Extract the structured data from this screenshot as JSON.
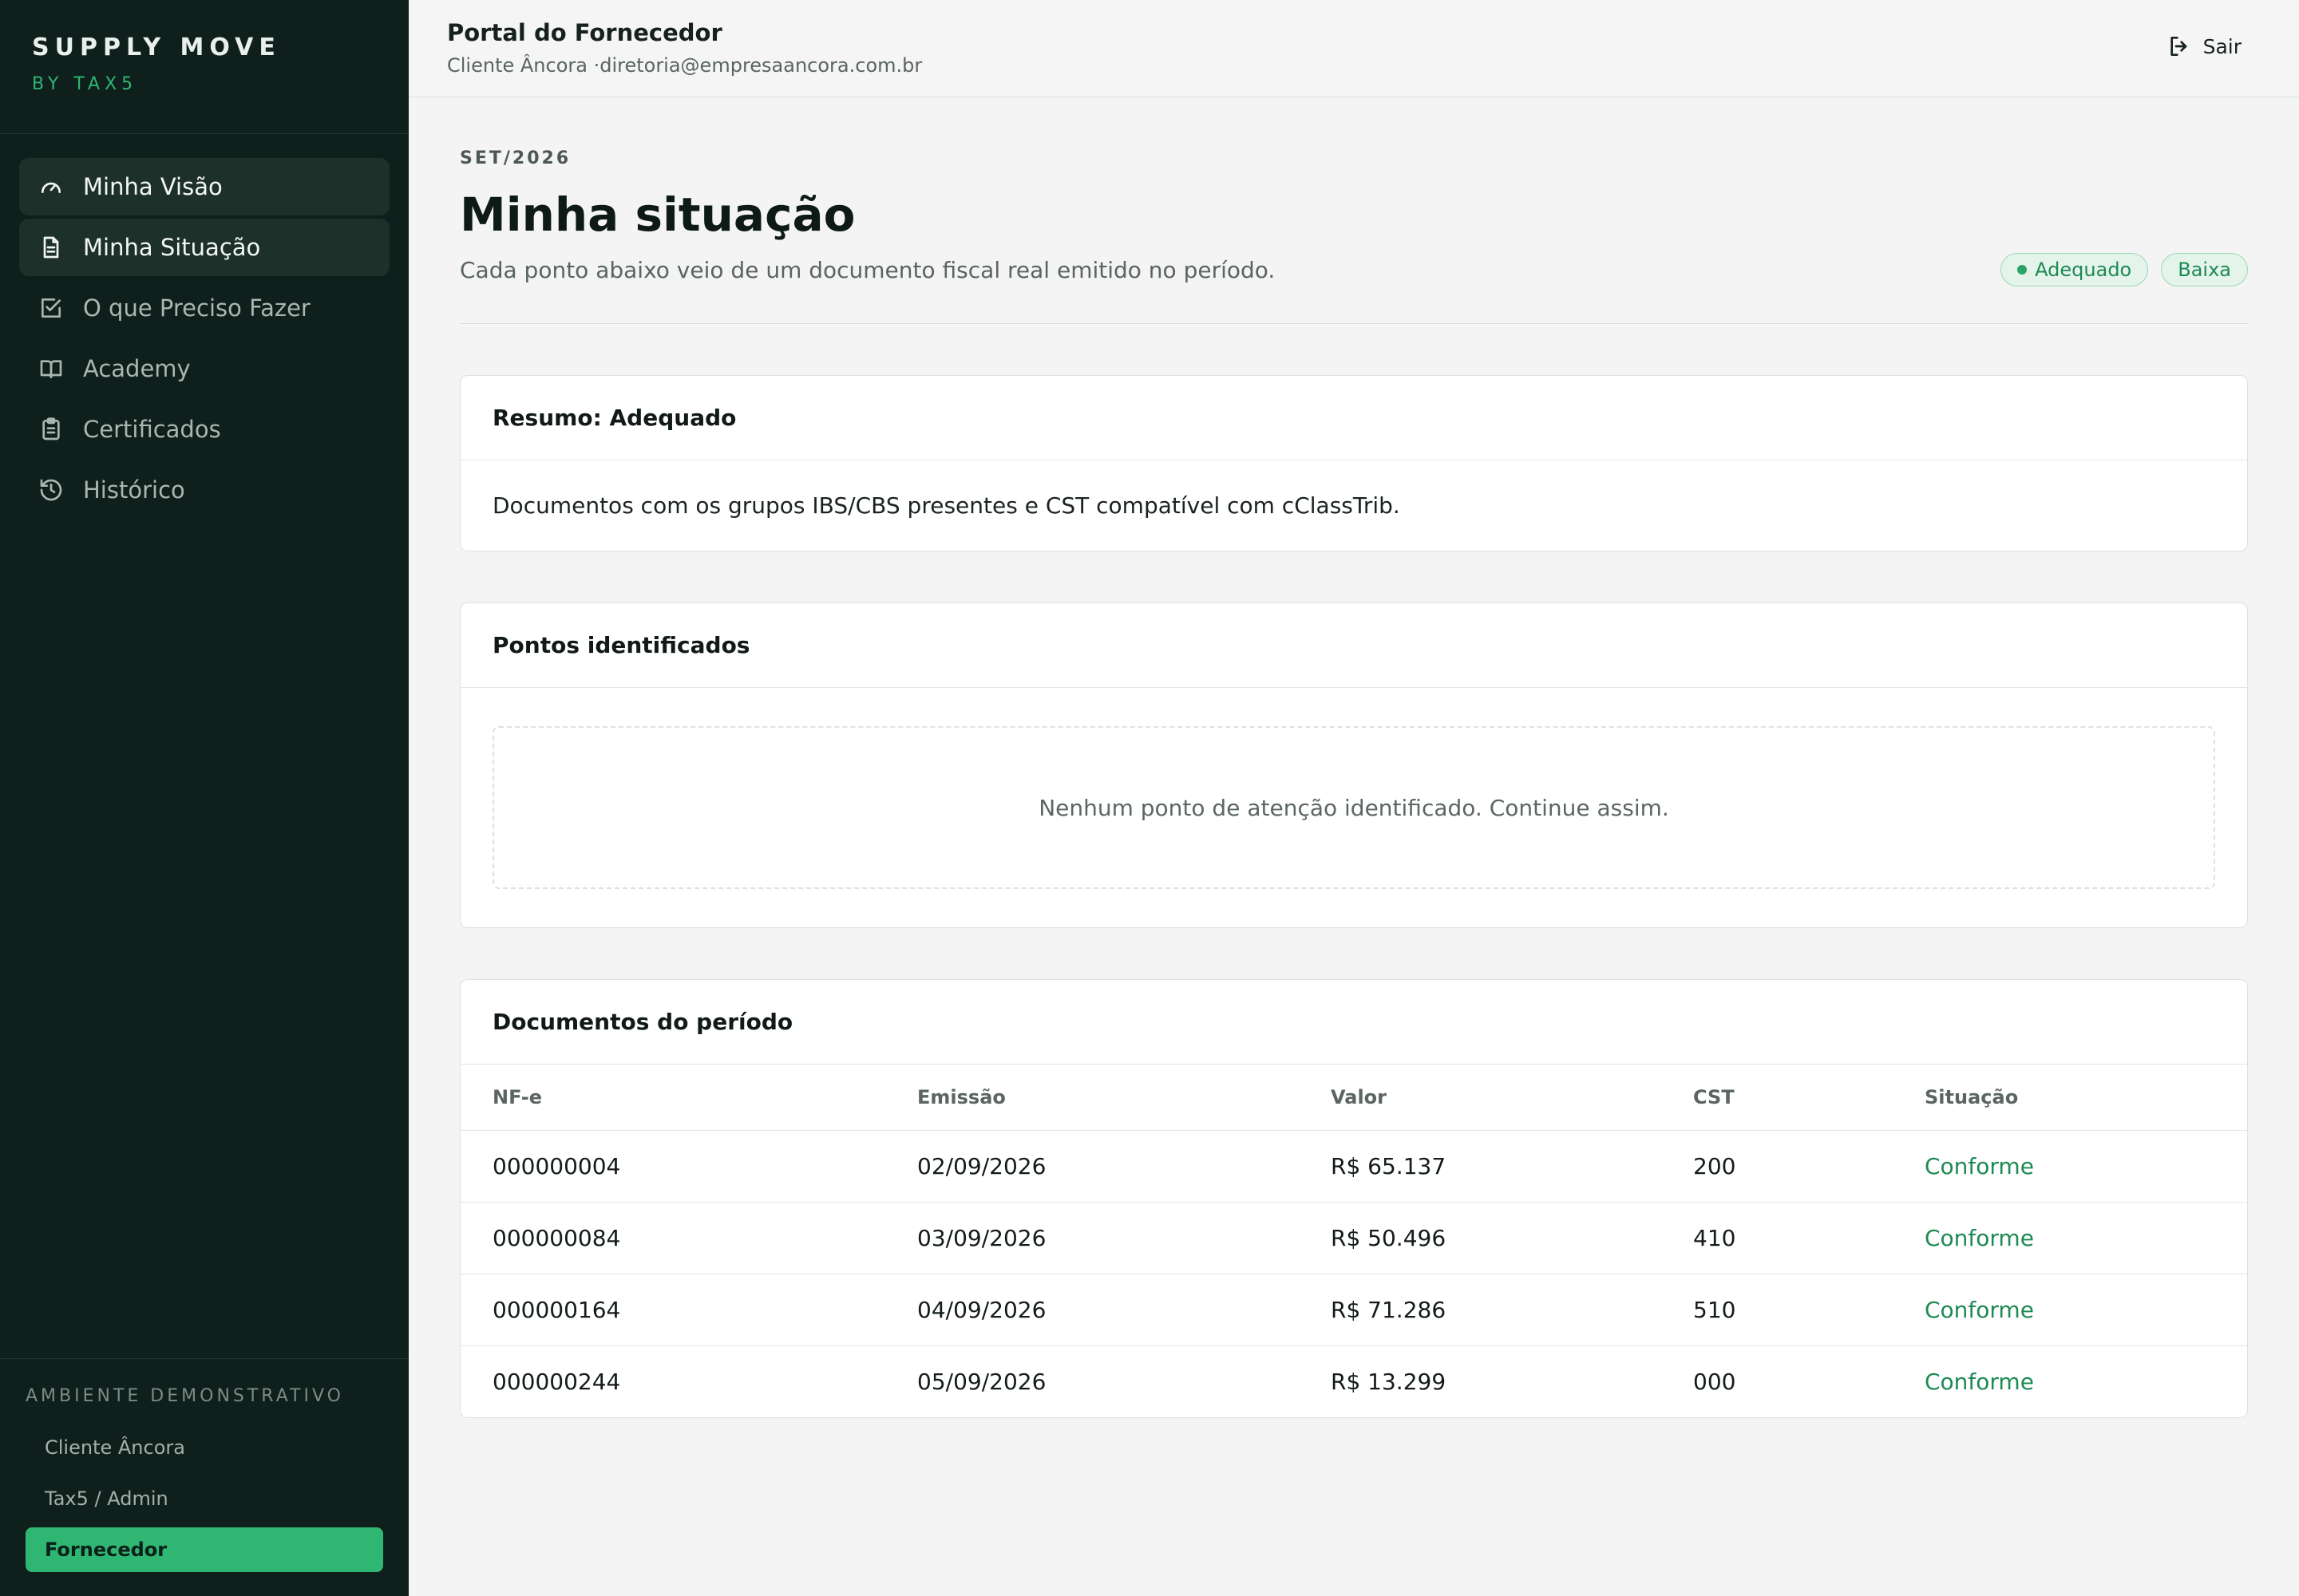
{
  "brand": {
    "title": "SUPPLY MOVE",
    "subtitle": "BY TAX5"
  },
  "nav": [
    {
      "label": "Minha Visão",
      "icon": "gauge-icon"
    },
    {
      "label": "Minha Situação",
      "icon": "document-icon"
    },
    {
      "label": "O que Preciso Fazer",
      "icon": "checkbox-icon"
    },
    {
      "label": "Academy",
      "icon": "book-icon"
    },
    {
      "label": "Certificados",
      "icon": "clipboard-icon"
    },
    {
      "label": "Histórico",
      "icon": "history-icon"
    }
  ],
  "demo": {
    "title": "AMBIENTE DEMONSTRATIVO",
    "items": [
      "Cliente Âncora",
      "Tax5 / Admin",
      "Fornecedor"
    ]
  },
  "header": {
    "title": "Portal do Fornecedor",
    "subtitle": "Cliente Âncora ·diretoria@empresaancora.com.br",
    "logout_label": "Sair"
  },
  "page": {
    "period": "SET/2026",
    "title": "Minha situação",
    "description": "Cada ponto abaixo veio de um documento fiscal real emitido no período.",
    "badges": [
      "Adequado",
      "Baixa"
    ]
  },
  "summary": {
    "title": "Resumo: Adequado",
    "text": "Documentos com os grupos IBS/CBS presentes e CST compatível com cClassTrib."
  },
  "points": {
    "title": "Pontos identificados",
    "empty": "Nenhum ponto de atenção identificado. Continue assim."
  },
  "documents": {
    "title": "Documentos do período",
    "columns": [
      "NF-e",
      "Emissão",
      "Valor",
      "CST",
      "Situação"
    ],
    "rows": [
      [
        "000000004",
        "02/09/2026",
        "R$ 65.137",
        "200",
        "Conforme"
      ],
      [
        "000000084",
        "03/09/2026",
        "R$ 50.496",
        "410",
        "Conforme"
      ],
      [
        "000000164",
        "04/09/2026",
        "R$ 71.286",
        "510",
        "Conforme"
      ],
      [
        "000000244",
        "05/09/2026",
        "R$ 13.299",
        "000",
        "Conforme"
      ]
    ]
  },
  "colors": {
    "sidebar_bg": "#0f1f1b",
    "accent": "#2fb673",
    "status_ok": "#1e8a53"
  }
}
